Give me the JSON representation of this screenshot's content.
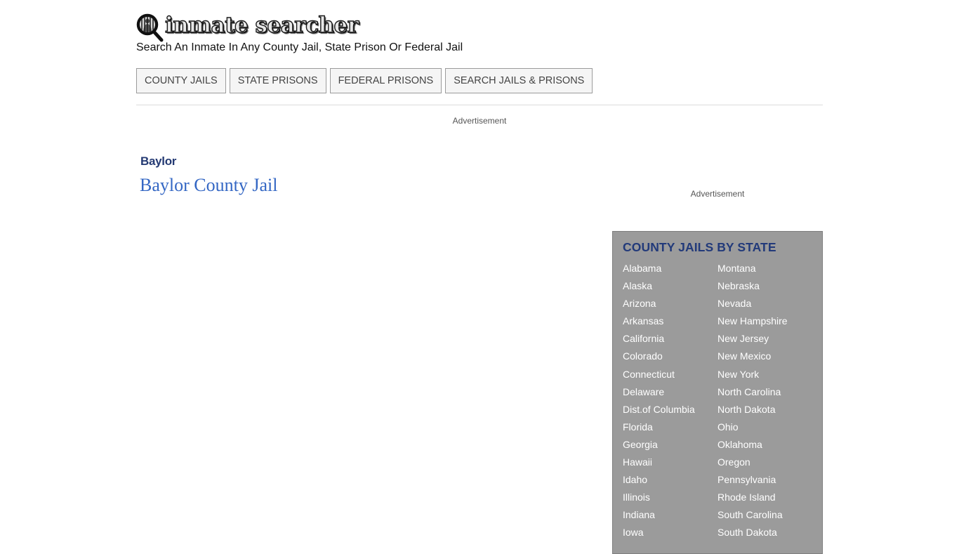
{
  "header": {
    "logo_text": "inmate searcher",
    "logo_icon": "magnifier-inmate-icon",
    "tagline": "Search An Inmate In Any County Jail, State Prison Or Federal Jail"
  },
  "nav": {
    "items": [
      {
        "label": "COUNTY JAILS"
      },
      {
        "label": "STATE PRISONS"
      },
      {
        "label": "FEDERAL PRISONS"
      },
      {
        "label": "SEARCH JAILS & PRISONS"
      }
    ]
  },
  "ads": {
    "top_label": "Advertisement",
    "side_label": "Advertisement"
  },
  "main": {
    "county": "Baylor",
    "jail_link": "Baylor County Jail"
  },
  "sidebar": {
    "title": "COUNTY JAILS BY STATE",
    "left_column": [
      "Alabama",
      "Alaska",
      "Arizona",
      "Arkansas",
      "California",
      "Colorado",
      "Connecticut",
      "Delaware",
      "Dist.of Columbia",
      "Florida",
      "Georgia",
      "Hawaii",
      "Idaho",
      "Illinois",
      "Indiana",
      "Iowa"
    ],
    "right_column": [
      "Montana",
      "Nebraska",
      "Nevada",
      "New Hampshire",
      "New Jersey",
      "New Mexico",
      "New York",
      "North Carolina",
      "North Dakota",
      "Ohio",
      "Oklahoma",
      "Oregon",
      "Pennsylvania",
      "Rhode Island",
      "South Carolina",
      "South Dakota"
    ]
  },
  "colors": {
    "county_label": "#243a73",
    "jail_link": "#3467c4",
    "sidebar_bg": "#9b9b9b",
    "sidebar_title": "#223a7a"
  }
}
